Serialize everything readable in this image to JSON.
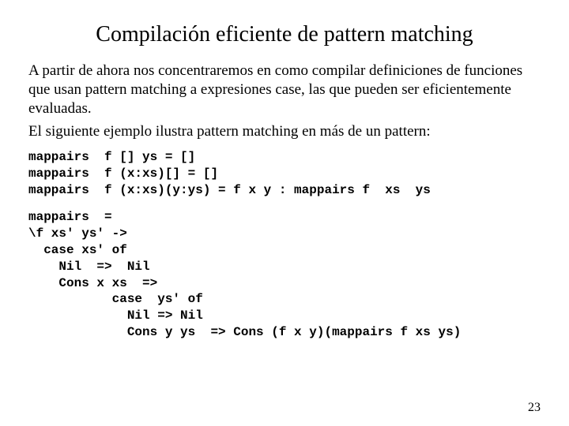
{
  "title": "Compilación eficiente de pattern matching",
  "para1": "A partir de ahora nos concentraremos en como compilar definiciones de funciones que usan pattern matching a expresiones case, las que pueden ser eficientemente evaluadas.",
  "para2": "El siguiente ejemplo ilustra pattern matching en más de un pattern:",
  "code1": "mappairs  f [] ys = []\nmappairs  f (x:xs)[] = []\nmappairs  f (x:xs)(y:ys) = f x y : mappairs f  xs  ys",
  "code2": "mappairs  =\n\\f xs' ys' ->\n  case xs' of\n    Nil  =>  Nil\n    Cons x xs  =>\n           case  ys' of\n             Nil => Nil\n             Cons y ys  => Cons (f x y)(mappairs f xs ys)",
  "page": "23"
}
